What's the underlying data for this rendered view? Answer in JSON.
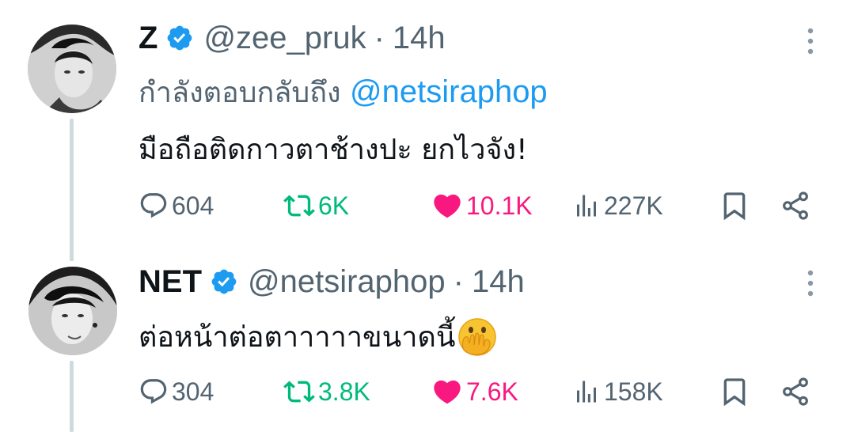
{
  "tweets": [
    {
      "display_name": "Z",
      "handle": "@zee_pruk",
      "separator": "·",
      "time": "14h",
      "reply_prefix": "กำลังตอบกลับถึง ",
      "reply_mention": "@netsiraphop",
      "text": "มือถือติดกาวตาช้างปะ ยกไวจัง!",
      "stats": {
        "replies": "604",
        "retweets": "6K",
        "likes": "10.1K",
        "views": "227K"
      },
      "avatar_icon": "profile-photo"
    },
    {
      "display_name": "NET",
      "handle": "@netsiraphop",
      "separator": "·",
      "time": "14h",
      "text": "ต่อหน้าต่อตาาาาาขนาดนี้",
      "emoji": "face-with-open-eyes-and-hand-over-mouth",
      "stats": {
        "replies": "304",
        "retweets": "3.8K",
        "likes": "7.6K",
        "views": "158K"
      },
      "avatar_icon": "profile-photo"
    }
  ],
  "colors": {
    "verified": "#1d9bf0",
    "mention": "#1d9bf0",
    "retweet": "#00ba7c",
    "like": "#f91880",
    "muted": "#536471",
    "text": "#0f1419",
    "thread_line": "#cfd9de"
  },
  "icons": {
    "reply": "reply-bubble-icon",
    "retweet": "retweet-icon",
    "like": "heart-icon",
    "views": "views-chart-icon",
    "bookmark": "bookmark-icon",
    "share": "share-icon",
    "more": "more-vertical-icon",
    "verified": "verified-badge-icon"
  }
}
